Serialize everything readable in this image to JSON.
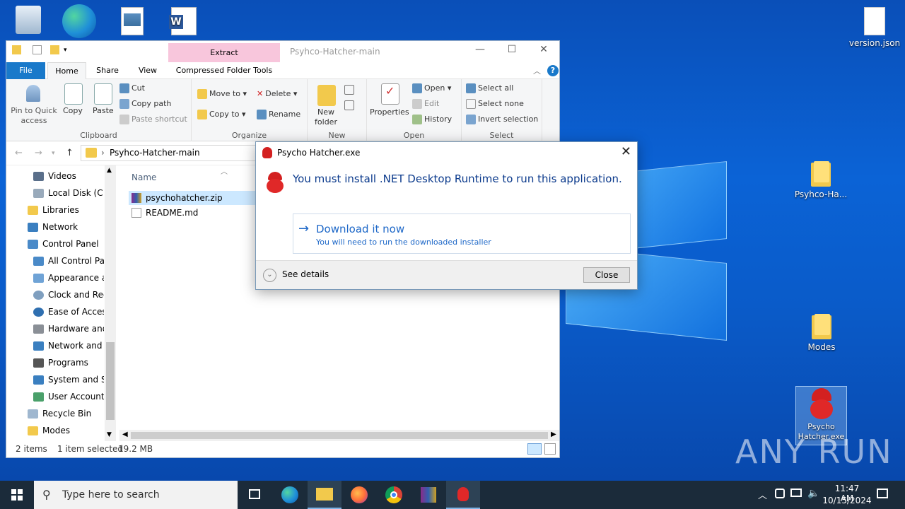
{
  "desktop": {
    "icons": [
      {
        "label": ""
      },
      {
        "label": ""
      },
      {
        "label": ""
      },
      {
        "label": ""
      },
      {
        "label": "version.json"
      },
      {
        "label": "Psyhco-Ha..."
      },
      {
        "label": "Modes"
      },
      {
        "label": "Psycho Hatcher.exe"
      }
    ],
    "watermark": "ANY RUN"
  },
  "explorer": {
    "title": "Psyhco-Hatcher-main",
    "contextual_tab": "Extract",
    "tabs": [
      "File",
      "Home",
      "Share",
      "View",
      "Compressed Folder Tools"
    ],
    "ribbon": {
      "clipboard": {
        "pin": "Pin to Quick access",
        "copy": "Copy",
        "paste": "Paste",
        "cut": "Cut",
        "copy_path": "Copy path",
        "paste_shortcut": "Paste shortcut",
        "label": "Clipboard"
      },
      "organize": {
        "move_to": "Move to",
        "copy_to": "Copy to",
        "delete": "Delete",
        "rename": "Rename",
        "label": "Organize"
      },
      "new": {
        "new_folder": "New folder",
        "label": "New"
      },
      "open": {
        "properties": "Properties",
        "open": "Open",
        "edit": "Edit",
        "history": "History",
        "label": "Open"
      },
      "select": {
        "select_all": "Select all",
        "select_none": "Select none",
        "invert": "Invert selection",
        "label": "Select"
      }
    },
    "address": "Psyhco-Hatcher-main",
    "nav_items": [
      "Videos",
      "Local Disk (C:)",
      "Libraries",
      "Network",
      "Control Panel",
      "All Control Par",
      "Appearance an",
      "Clock and Regi",
      "Ease of Access",
      "Hardware and",
      "Network and Ir",
      "Programs",
      "System and Sec",
      "User Accounts",
      "Recycle Bin",
      "Modes"
    ],
    "column_name": "Name",
    "files": [
      {
        "name": "psychohatcher.zip",
        "selected": true
      },
      {
        "name": "README.md",
        "selected": false
      }
    ],
    "status": {
      "count": "2 items",
      "selection": "1 item selected",
      "size": "19.2 MB"
    }
  },
  "dialog": {
    "title": "Psycho Hatcher.exe",
    "message": "You must install .NET Desktop Runtime to run this application.",
    "link_title": "Download it now",
    "link_sub": "You will need to run the downloaded installer",
    "details": "See details",
    "close": "Close"
  },
  "taskbar": {
    "search_placeholder": "Type here to search",
    "time": "11:47 AM",
    "date": "10/15/2024"
  }
}
